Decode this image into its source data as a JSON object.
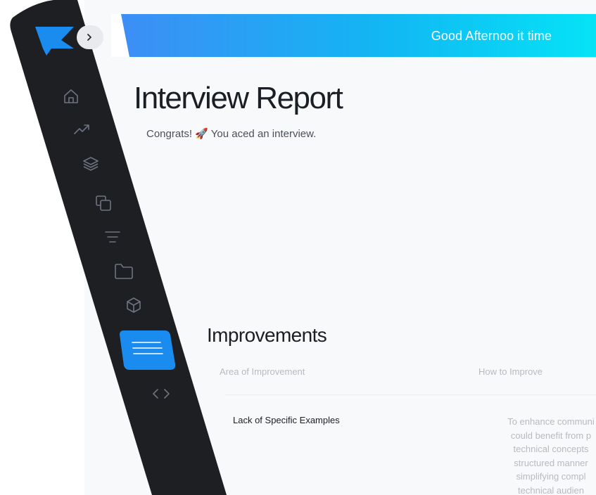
{
  "header": {
    "greeting": "Good Afternoo it time"
  },
  "sidebar": {
    "expand_icon": "chevron-right-icon",
    "items": [
      {
        "icon": "home-icon"
      },
      {
        "icon": "trending-up-icon"
      },
      {
        "icon": "layers-icon"
      },
      {
        "icon": "copy-icon"
      },
      {
        "icon": "align-center-icon"
      },
      {
        "icon": "folder-icon"
      },
      {
        "icon": "box-icon"
      },
      {
        "icon": "menu-icon",
        "active": true
      },
      {
        "icon": "code-icon"
      }
    ]
  },
  "page": {
    "title": "Interview Report",
    "subtitle": "Congrats! 🚀 You aced an interview."
  },
  "improvements": {
    "title": "Improvements",
    "columns": [
      "Area of Improvement",
      "How to Improve"
    ],
    "rows": [
      {
        "area": "Lack of Specific Examples",
        "how_lines": [
          "To enhance communi",
          "could benefit from p",
          "technical concepts",
          "structured manner",
          "simplifying compl",
          "technical audien"
        ]
      }
    ]
  },
  "colors": {
    "sidebar": "#1e1f23",
    "accent": "#1a8cf0",
    "banner_start": "#3f8cf5",
    "banner_end": "#05e3f6"
  }
}
